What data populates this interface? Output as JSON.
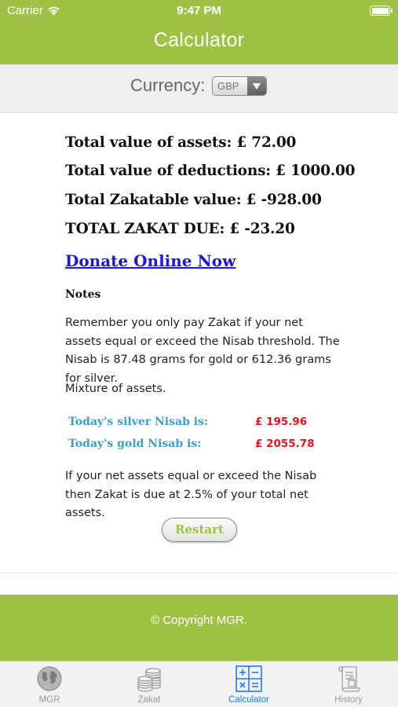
{
  "status_bar": {
    "carrier": "Carrier",
    "time": "9:47 PM"
  },
  "nav": {
    "title": "Calculator"
  },
  "currency": {
    "label": "Currency:",
    "selected": "GBP"
  },
  "totals": {
    "assets": "Total value of assets: £ 72.00",
    "deductions": "Total value of deductions: £ 1000.00",
    "zakatable": "Total Zakatable value: £ -928.00",
    "due": "TOTAL ZAKAT DUE: £ -23.20"
  },
  "donate_label": "Donate Online Now",
  "notes": {
    "title": "Notes",
    "paragraph1": "Remember you only pay Zakat if your net assets equal or exceed the Nisab threshold. The Nisab is 87.48 grams for gold or 612.36 grams for silver.",
    "paragraph2": "Mixture of assets.",
    "silver_label": "Today's silver Nisab is:",
    "silver_value": "£ 195.96",
    "gold_label": "Today's gold Nisab is:",
    "gold_value": "£ 2055.78",
    "paragraph3": "If your net assets equal or exceed the Nisab then Zakat is due at 2.5% of your total net assets."
  },
  "restart_label": "Restart",
  "footer": {
    "copyright": "© Copyright MGR."
  },
  "tabs": [
    {
      "label": "MGR",
      "icon": "globe-icon",
      "active": false
    },
    {
      "label": "Zakat",
      "icon": "coins-icon",
      "active": false
    },
    {
      "label": "Calculator",
      "icon": "calculator-icon",
      "active": true
    },
    {
      "label": "History",
      "icon": "scroll-icon",
      "active": false
    }
  ],
  "colors": {
    "brand_green": "#9fc245",
    "link_blue": "#1f14e0",
    "nisab_label": "#3a9fc8",
    "nisab_value": "#e3131b",
    "tab_active": "#1a7bff"
  }
}
